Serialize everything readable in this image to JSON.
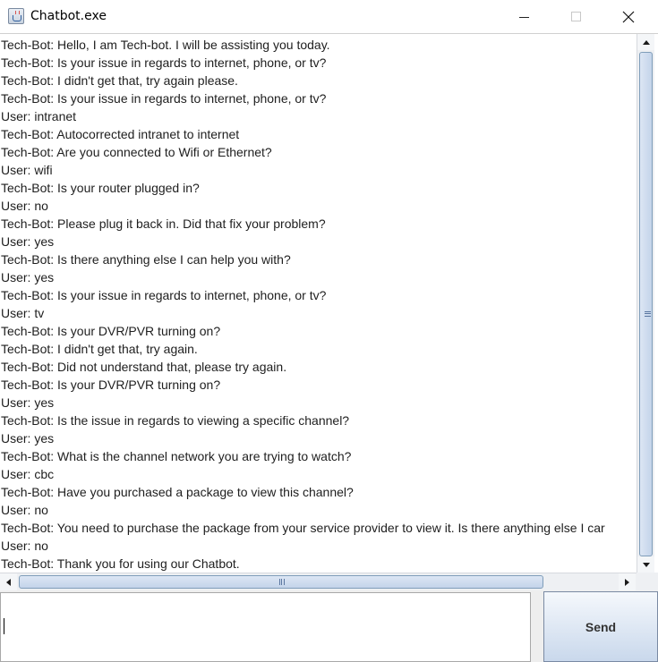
{
  "window": {
    "title": "Chatbot.exe",
    "icons": {
      "app": "java-cup-icon",
      "minimize": "minimize-icon",
      "maximize": "maximize-icon",
      "close": "close-icon"
    }
  },
  "chat": {
    "lines": [
      "Tech-Bot: Hello, I am Tech-bot. I will be assisting you today.",
      "Tech-Bot: Is your issue in regards to internet, phone, or tv?",
      "Tech-Bot: I didn't get that, try again please.",
      "Tech-Bot: Is your issue in regards to internet, phone, or tv?",
      "User: intranet",
      "Tech-Bot: Autocorrected intranet to internet",
      "Tech-Bot: Are you connected to Wifi or Ethernet?",
      "User: wifi",
      "Tech-Bot: Is your router plugged in?",
      "User: no",
      "Tech-Bot: Please plug it back in. Did that fix your problem?",
      "User: yes",
      "Tech-Bot: Is there anything else I can help you with?",
      "User: yes",
      "Tech-Bot: Is your issue in regards to internet, phone, or tv?",
      "User: tv",
      "Tech-Bot: Is your DVR/PVR turning on?",
      "Tech-Bot: I didn't get that, try again.",
      "Tech-Bot: Did not understand that, please try again.",
      "Tech-Bot: Is your DVR/PVR turning on?",
      "User: yes",
      "Tech-Bot: Is the issue in regards to viewing a specific channel?",
      "User: yes",
      "Tech-Bot: What is the channel network you are trying to watch?",
      "User: cbc",
      "Tech-Bot: Have you purchased a package to view this channel?",
      "User: no",
      "Tech-Bot: You need to purchase the package from your service provider to view it. Is there anything else I car",
      "User: no",
      "Tech-Bot: Thank you for using our Chatbot."
    ]
  },
  "input": {
    "value": ""
  },
  "send": {
    "label": "Send"
  },
  "colors": {
    "thumb": "#c4d4ea",
    "thumb_border": "#7f9db9",
    "text": "#1e1e1e"
  }
}
